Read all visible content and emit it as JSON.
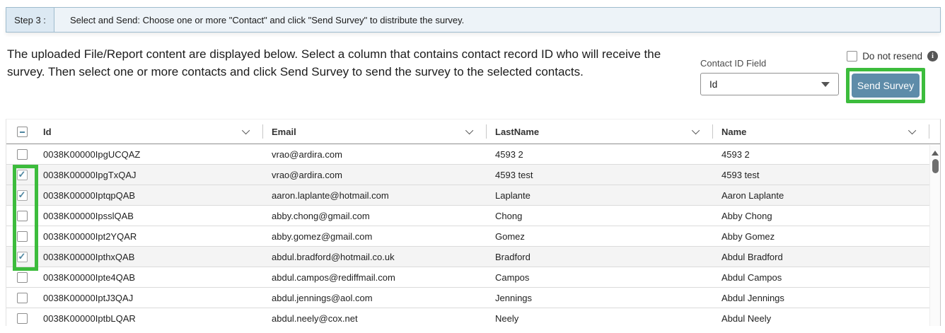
{
  "step_bar": {
    "step_label": "Step 3 :",
    "message": "Select and Send: Choose one or more \"Contact\" and click \"Send Survey\" to distribute the survey."
  },
  "intro": {
    "text": "The uploaded File/Report content are displayed below. Select a column that contains contact record ID who will receive the survey. Then select one or more contacts and click Send Survey to send the survey to the selected contacts."
  },
  "controls": {
    "do_not_resend_label": "Do not resend",
    "do_not_resend_checked": false,
    "info_icon": "info-circle-icon",
    "contact_id_field_label": "Contact ID Field",
    "contact_id_selected": "Id",
    "dropdown_icon": "caret-down-icon",
    "send_survey_label": "Send Survey"
  },
  "colors": {
    "accent_green": "#3CBC3C",
    "button_blue": "#5E8CA9",
    "button_text": "#FFFFFF",
    "step_bar_bg": "#EDF3F8",
    "step_label_bg": "#DCE9F3",
    "step_bar_border": "#9FBCCE",
    "check_teal": "#4E86A0",
    "header_text": "#333333",
    "cell_text": "#1F1F1F",
    "row_border": "#DBDBDB",
    "selected_row_bg": "#F4F4F4",
    "scroll_thumb": "#6E6E6E",
    "info_icon_bg": "#565656"
  },
  "table": {
    "columns": [
      "Id",
      "Email",
      "LastName",
      "Name"
    ],
    "column_sort_icon": "chevron-down-icon",
    "select_all_state": "indeterminate",
    "scrollbar": {
      "up_icon": "caret-up-icon",
      "thumb": "scroll-thumb"
    },
    "rows": [
      {
        "checked": false,
        "id": "0038K00000IpgUCQAZ",
        "email": "vrao@ardira.com",
        "last_name": "4593 2",
        "name": "4593 2"
      },
      {
        "checked": true,
        "id": "0038K00000IpgTxQAJ",
        "email": "vrao@ardira.com",
        "last_name": "4593 test",
        "name": "4593 test"
      },
      {
        "checked": true,
        "id": "0038K00000IptqpQAB",
        "email": "aaron.laplante@hotmail.com",
        "last_name": "Laplante",
        "name": "Aaron Laplante"
      },
      {
        "checked": false,
        "id": "0038K00000IpsslQAB",
        "email": "abby.chong@gmail.com",
        "last_name": "Chong",
        "name": "Abby Chong"
      },
      {
        "checked": false,
        "id": "0038K00000Ipt2YQAR",
        "email": "abby.gomez@gmail.com",
        "last_name": "Gomez",
        "name": "Abby Gomez"
      },
      {
        "checked": true,
        "id": "0038K00000IpthxQAB",
        "email": "abdul.bradford@hotmail.co.uk",
        "last_name": "Bradford",
        "name": "Abdul Bradford"
      },
      {
        "checked": false,
        "id": "0038K00000Ipte4QAB",
        "email": "abdul.campos@rediffmail.com",
        "last_name": "Campos",
        "name": "Abdul Campos"
      },
      {
        "checked": false,
        "id": "0038K00000IptJ3QAJ",
        "email": "abdul.jennings@aol.com",
        "last_name": "Jennings",
        "name": "Abdul Jennings"
      },
      {
        "checked": false,
        "id": "0038K00000IptbLQAR",
        "email": "abdul.neely@cox.net",
        "last_name": "Neely",
        "name": "Abdul Neely"
      }
    ]
  },
  "annotations": {
    "send_survey_highlight": "green-box",
    "checkbox_column_highlight": "green-box"
  }
}
